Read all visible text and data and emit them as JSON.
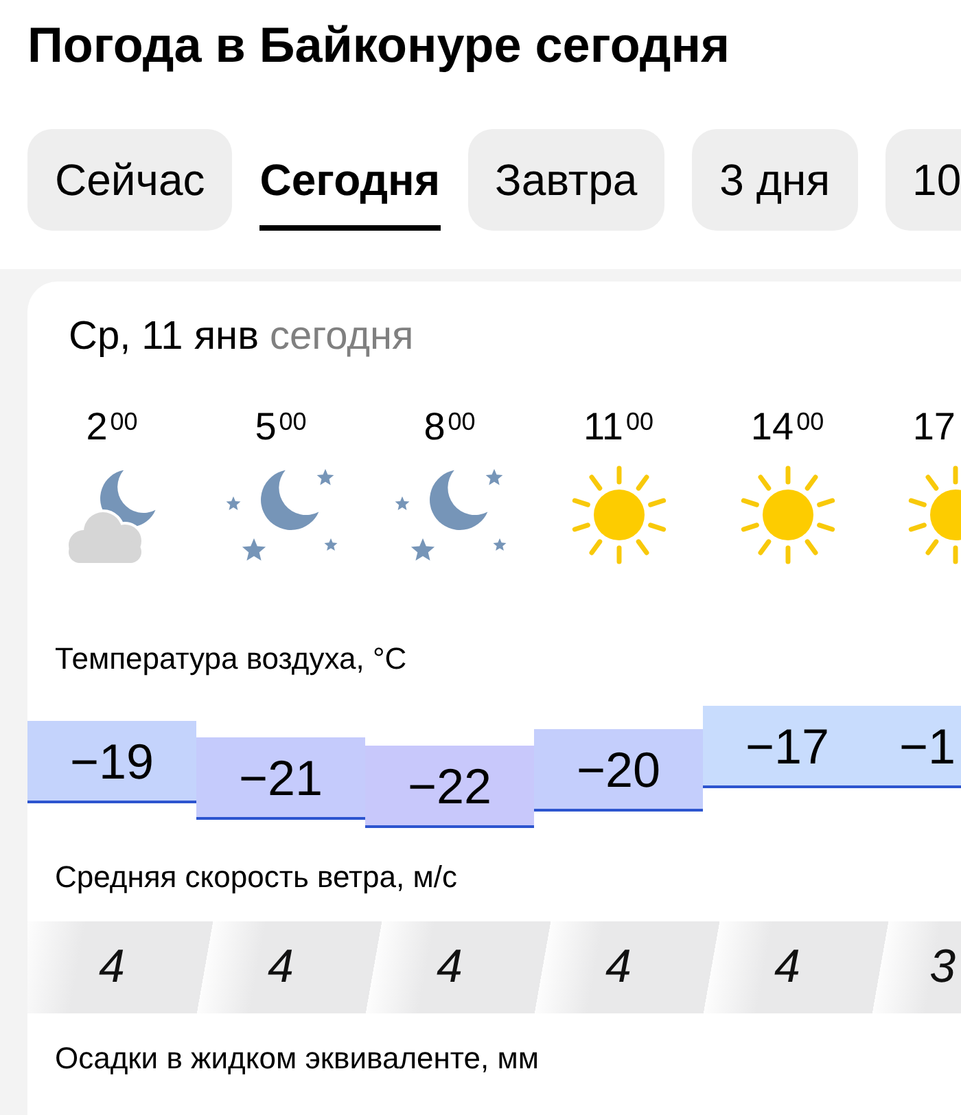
{
  "title": "Погода в Байконуре сегодня",
  "tabs": [
    {
      "label": "Сейчас",
      "selected": false
    },
    {
      "label": "Сегодня",
      "selected": true
    },
    {
      "label": "Завтра",
      "selected": false
    },
    {
      "label": "3 дня",
      "selected": false
    },
    {
      "label": "10",
      "selected": false
    }
  ],
  "day": {
    "date": "Ср, 11 янв",
    "note": "сегодня"
  },
  "hours": [
    {
      "hour": "2",
      "minutes": "00",
      "kind": "cloudy-night"
    },
    {
      "hour": "5",
      "minutes": "00",
      "kind": "clear-night"
    },
    {
      "hour": "8",
      "minutes": "00",
      "kind": "clear-night"
    },
    {
      "hour": "11",
      "minutes": "00",
      "kind": "clear-day"
    },
    {
      "hour": "14",
      "minutes": "00",
      "kind": "clear-day"
    },
    {
      "hour": "17",
      "kind": "clear-day"
    }
  ],
  "temperature": {
    "label": "Температура воздуха, °C",
    "values": [
      {
        "value": "−19",
        "color": "#c4d3fc"
      },
      {
        "value": "−21",
        "color": "#c5cbfc"
      },
      {
        "value": "−22",
        "color": "#c8c8fb"
      },
      {
        "value": "−20",
        "color": "#c4cefc"
      },
      {
        "value": "−17",
        "color": "#c8dcfd"
      },
      {
        "value": "−1",
        "color": "#c8dcfd"
      }
    ]
  },
  "wind": {
    "label": "Средняя скорость ветра, м/с",
    "values": [
      "4",
      "4",
      "4",
      "4",
      "4",
      "3"
    ]
  },
  "precipitation": {
    "label": "Осадки в жидком эквиваленте, мм"
  }
}
